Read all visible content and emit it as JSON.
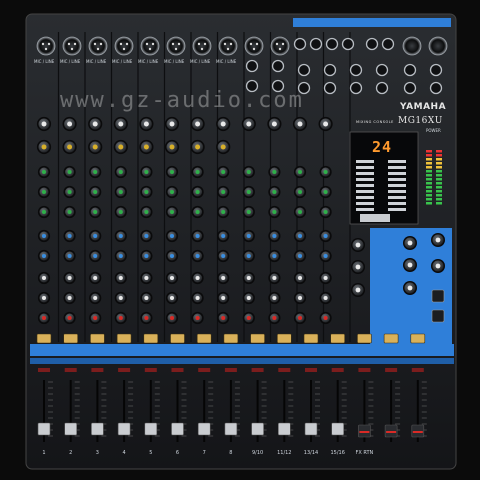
{
  "brand": {
    "logo": "YAMAHA",
    "model": "MG16XU",
    "series": "MIXING CONSOLE"
  },
  "watermark": "www.gz-audio.com",
  "display": {
    "value": "24"
  },
  "channel_labels": {
    "mic_line": "MIC / LINE",
    "power": "POWER",
    "peak": "PEAK"
  },
  "channel_numbers": [
    "1",
    "2",
    "3",
    "4",
    "5",
    "6",
    "7",
    "8",
    "9/10",
    "11/12",
    "13/14",
    "15/16",
    "FX RTN"
  ],
  "colors": {
    "chassis": "#1a1c1f",
    "blue_accent": "#2f7fd9",
    "knob_green": "#2fb04a",
    "knob_blue": "#3a8ee0",
    "knob_red": "#d92a26",
    "knob_yellow": "#d8b02a",
    "display_amber": "#ff9a2e"
  }
}
